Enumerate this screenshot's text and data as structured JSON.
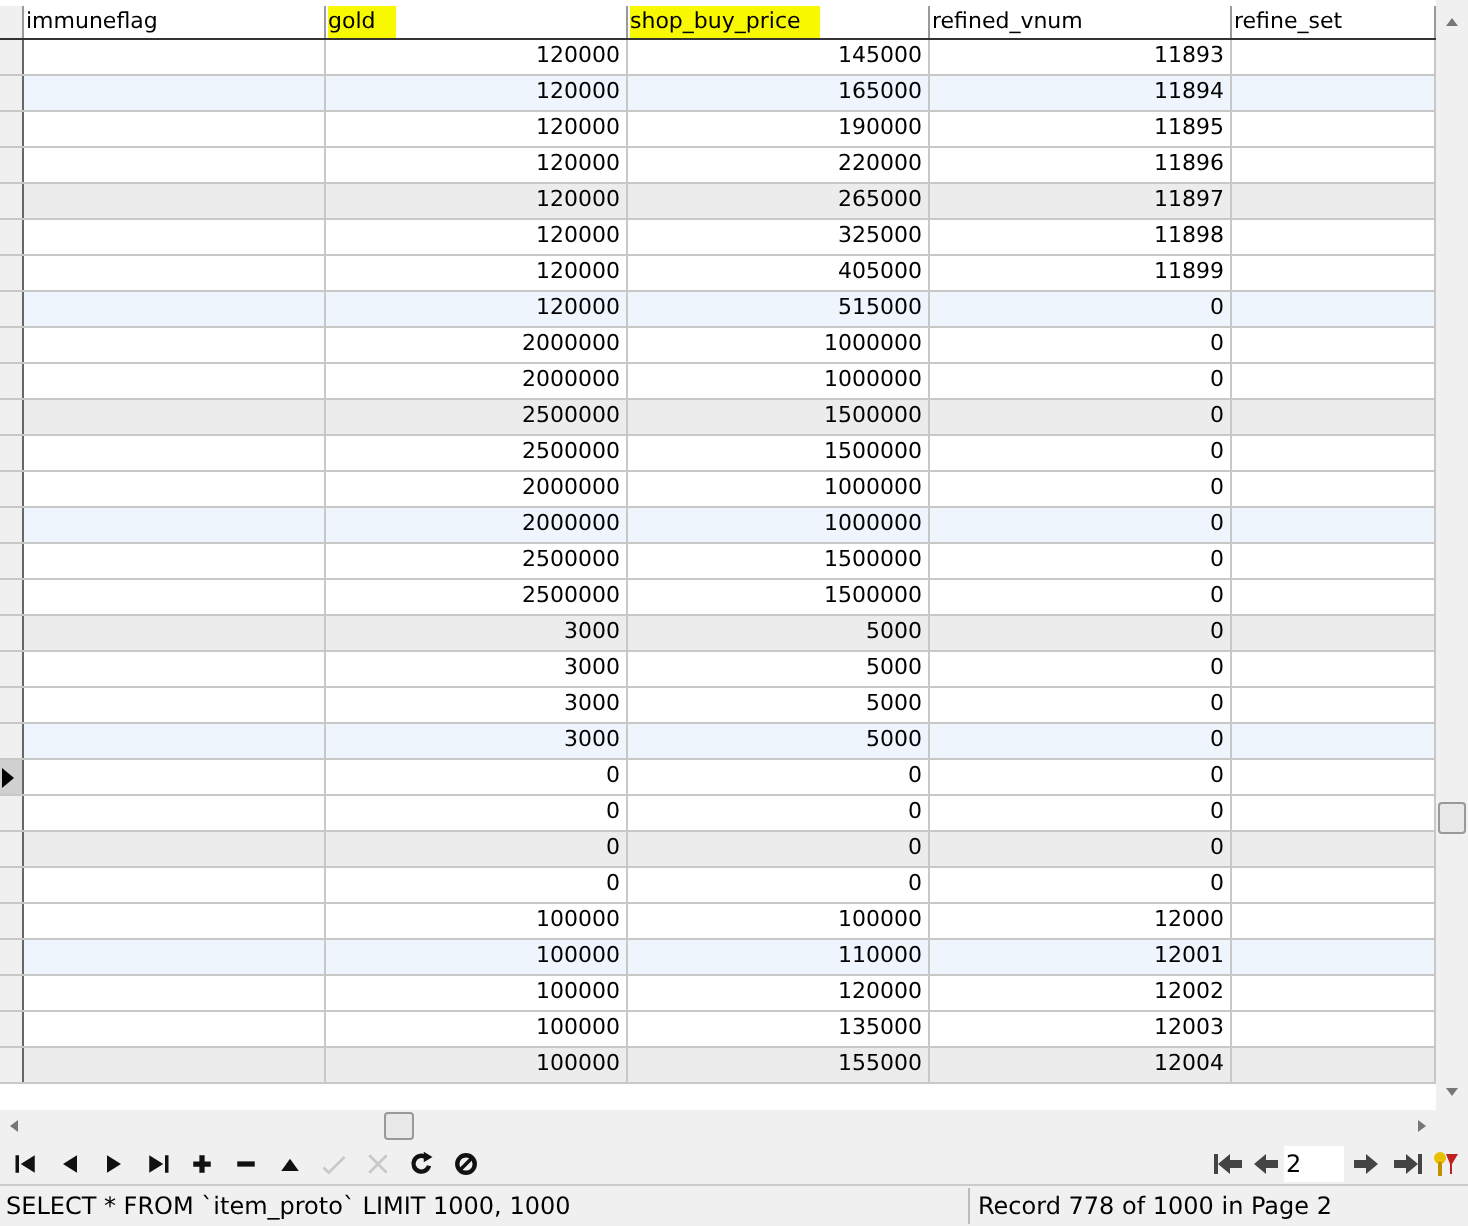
{
  "table": {
    "columns": [
      {
        "label": "immuneflag",
        "highlighted": false
      },
      {
        "label": "gold",
        "highlighted": true
      },
      {
        "label": "shop_buy_price",
        "highlighted": true
      },
      {
        "label": "refined_vnum",
        "highlighted": false
      },
      {
        "label": "refine_set",
        "highlighted": false
      }
    ],
    "rows": [
      {
        "cells": [
          "",
          "120000",
          "145000",
          "11893",
          ""
        ],
        "color": "#ffffff",
        "current": false
      },
      {
        "cells": [
          "",
          "120000",
          "165000",
          "11894",
          ""
        ],
        "color": "#eef5fc",
        "current": false
      },
      {
        "cells": [
          "",
          "120000",
          "190000",
          "11895",
          ""
        ],
        "color": "#ffffff",
        "current": false
      },
      {
        "cells": [
          "",
          "120000",
          "220000",
          "11896",
          ""
        ],
        "color": "#ffffff",
        "current": false
      },
      {
        "cells": [
          "",
          "120000",
          "265000",
          "11897",
          ""
        ],
        "color": "#ececec",
        "current": false
      },
      {
        "cells": [
          "",
          "120000",
          "325000",
          "11898",
          ""
        ],
        "color": "#ffffff",
        "current": false
      },
      {
        "cells": [
          "",
          "120000",
          "405000",
          "11899",
          ""
        ],
        "color": "#ffffff",
        "current": false
      },
      {
        "cells": [
          "",
          "120000",
          "515000",
          "0",
          ""
        ],
        "color": "#eef5fc",
        "current": false
      },
      {
        "cells": [
          "",
          "2000000",
          "1000000",
          "0",
          ""
        ],
        "color": "#ffffff",
        "current": false
      },
      {
        "cells": [
          "",
          "2000000",
          "1000000",
          "0",
          ""
        ],
        "color": "#ffffff",
        "current": false
      },
      {
        "cells": [
          "",
          "2500000",
          "1500000",
          "0",
          ""
        ],
        "color": "#ececec",
        "current": false
      },
      {
        "cells": [
          "",
          "2500000",
          "1500000",
          "0",
          ""
        ],
        "color": "#ffffff",
        "current": false
      },
      {
        "cells": [
          "",
          "2000000",
          "1000000",
          "0",
          ""
        ],
        "color": "#ffffff",
        "current": false
      },
      {
        "cells": [
          "",
          "2000000",
          "1000000",
          "0",
          ""
        ],
        "color": "#eef5fc",
        "current": false
      },
      {
        "cells": [
          "",
          "2500000",
          "1500000",
          "0",
          ""
        ],
        "color": "#ffffff",
        "current": false
      },
      {
        "cells": [
          "",
          "2500000",
          "1500000",
          "0",
          ""
        ],
        "color": "#ffffff",
        "current": false
      },
      {
        "cells": [
          "",
          "3000",
          "5000",
          "0",
          ""
        ],
        "color": "#ececec",
        "current": false
      },
      {
        "cells": [
          "",
          "3000",
          "5000",
          "0",
          ""
        ],
        "color": "#ffffff",
        "current": false
      },
      {
        "cells": [
          "",
          "3000",
          "5000",
          "0",
          ""
        ],
        "color": "#ffffff",
        "current": false
      },
      {
        "cells": [
          "",
          "3000",
          "5000",
          "0",
          ""
        ],
        "color": "#eef5fc",
        "current": false
      },
      {
        "cells": [
          "",
          "0",
          "0",
          "0",
          ""
        ],
        "color": "#ffffff",
        "current": true
      },
      {
        "cells": [
          "",
          "0",
          "0",
          "0",
          ""
        ],
        "color": "#ffffff",
        "current": false
      },
      {
        "cells": [
          "",
          "0",
          "0",
          "0",
          ""
        ],
        "color": "#ececec",
        "current": false
      },
      {
        "cells": [
          "",
          "0",
          "0",
          "0",
          ""
        ],
        "color": "#ffffff",
        "current": false
      },
      {
        "cells": [
          "",
          "100000",
          "100000",
          "12000",
          ""
        ],
        "color": "#ffffff",
        "current": false
      },
      {
        "cells": [
          "",
          "100000",
          "110000",
          "12001",
          ""
        ],
        "color": "#eef5fc",
        "current": false
      },
      {
        "cells": [
          "",
          "100000",
          "120000",
          "12002",
          ""
        ],
        "color": "#ffffff",
        "current": false
      },
      {
        "cells": [
          "",
          "100000",
          "135000",
          "12003",
          ""
        ],
        "color": "#ffffff",
        "current": false
      },
      {
        "cells": [
          "",
          "100000",
          "155000",
          "12004",
          ""
        ],
        "color": "#ececec",
        "current": false
      }
    ]
  },
  "toolbar": [
    {
      "kind": "first",
      "disabled": false
    },
    {
      "kind": "prev",
      "disabled": false
    },
    {
      "kind": "next",
      "disabled": false
    },
    {
      "kind": "last",
      "disabled": false
    },
    {
      "kind": "add",
      "disabled": false
    },
    {
      "kind": "remove",
      "disabled": false
    },
    {
      "kind": "up",
      "disabled": false
    },
    {
      "kind": "check",
      "disabled": true
    },
    {
      "kind": "cancel",
      "disabled": true
    },
    {
      "kind": "refresh",
      "disabled": false
    },
    {
      "kind": "stop",
      "disabled": false
    }
  ],
  "pager": {
    "page": "2"
  },
  "status_bar": {
    "query": "SELECT * FROM `item_proto` LIMIT 1000, 1000",
    "record": "Record 778 of 1000 in Page 2"
  }
}
